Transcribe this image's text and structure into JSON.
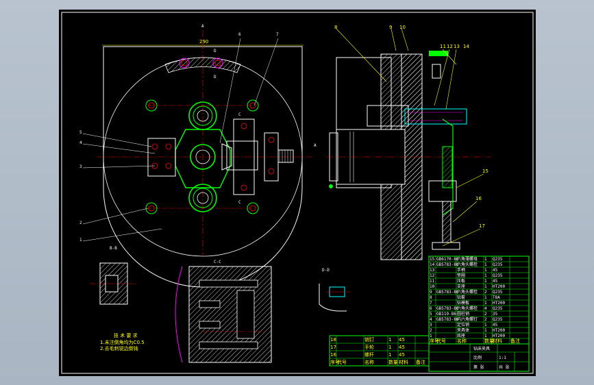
{
  "views": {
    "section_top": "A",
    "section_top_right": "A",
    "section_bb": "B-B",
    "section_cc": "C-C",
    "section_dd": "D-D",
    "dim_width": "290"
  },
  "balloons_left": [
    "5",
    "4",
    "3",
    "2",
    "1"
  ],
  "balloons_top": [
    "6",
    "7"
  ],
  "balloons_right": [
    "8",
    "9",
    "10",
    "11",
    "12",
    "13",
    "14",
    "15",
    "16",
    "17"
  ],
  "tech_notes": {
    "title": "技 术 要 求",
    "line1": "1.未注倒角均为C0.5",
    "line2": "2.去毛刺锐边倒钝"
  },
  "bom_rows": [
    [
      "15",
      "GB6170-86",
      "六角薄螺母",
      "1",
      "Q235"
    ],
    [
      "14",
      "GB5783-86",
      "六角头螺栓",
      "1",
      "Q235"
    ],
    [
      "13",
      "",
      "手柄",
      "1",
      "45"
    ],
    [
      "12",
      "",
      "垫圈",
      "1",
      "Q235"
    ],
    [
      "11",
      "",
      "压板",
      "1",
      "45"
    ],
    [
      "10",
      "",
      "支座",
      "1",
      "HT200"
    ],
    [
      "9",
      "GB5783-86",
      "六角头螺栓",
      "2",
      "Q235"
    ],
    [
      "8",
      "",
      "钻套",
      "1",
      "T8A"
    ],
    [
      "7",
      "",
      "钻模板",
      "1",
      "HT200"
    ],
    [
      "6",
      "GB5783-86",
      "六角头螺栓",
      "4",
      "Q235"
    ],
    [
      "5",
      "GB119-86",
      "圆柱销",
      "2",
      "35"
    ],
    [
      "4",
      "GB5783-86",
      "内六角螺钉",
      "2",
      "Q235"
    ],
    [
      "3",
      "",
      "定位销",
      "1",
      "45"
    ],
    [
      "2",
      "",
      "夹具体",
      "1",
      "HT200"
    ],
    [
      "1",
      "",
      "底座",
      "1",
      "HT200"
    ]
  ],
  "bom_header": [
    "序号",
    "代号",
    "名称",
    "数量",
    "材料",
    "备注"
  ],
  "left_bom_rows": [
    [
      "18",
      "",
      "销钉",
      "1",
      "45"
    ],
    [
      "17",
      "",
      "手轮",
      "1",
      "45"
    ],
    [
      "16",
      "",
      "螺杆",
      "1",
      "45"
    ]
  ],
  "title_block": {
    "drawing_name": "钻床夹具",
    "scale_label": "比例",
    "scale_value": "1:1",
    "sheet_label": "共  张",
    "page_label": "第  张"
  },
  "colors": {
    "background": "#000000",
    "outline": "#ffffff",
    "center_line": "#ff0000",
    "dimension": "#ffff00",
    "hatch": "#ffffff",
    "green_part": "#00ff00",
    "magenta": "#ff00ff",
    "cyan": "#00ffff"
  }
}
